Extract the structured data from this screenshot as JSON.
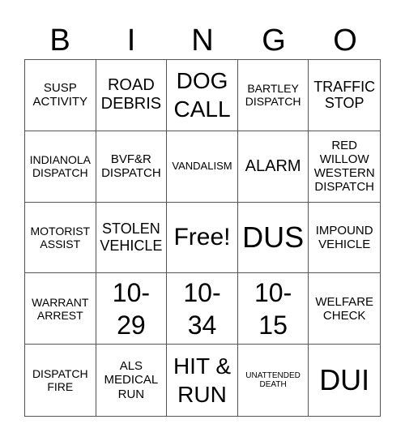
{
  "header": {
    "letters": [
      "B",
      "I",
      "N",
      "G",
      "O"
    ]
  },
  "board": {
    "rows": [
      [
        {
          "text": "SUSP\nACTIVITY"
        },
        {
          "text": "ROAD\nDEBRIS"
        },
        {
          "text": "DOG\nCALL"
        },
        {
          "text": "BARTLEY\nDISPATCH"
        },
        {
          "text": "TRAFFIC\nSTOP"
        }
      ],
      [
        {
          "text": "INDIANOLA\nDISPATCH"
        },
        {
          "text": "BVF&R\nDISPATCH"
        },
        {
          "text": "VANDALISM"
        },
        {
          "text": "ALARM"
        },
        {
          "text": "RED\nWILLOW\nWESTERN\nDISPATCH"
        }
      ],
      [
        {
          "text": "MOTORIST\nASSIST"
        },
        {
          "text": "STOLEN\nVEHICLE"
        },
        {
          "text": "Free!"
        },
        {
          "text": "DUS"
        },
        {
          "text": "IMPOUND\nVEHICLE"
        }
      ],
      [
        {
          "text": "WARRANT\nARREST"
        },
        {
          "text": "10-\n29"
        },
        {
          "text": "10-\n34"
        },
        {
          "text": "10-\n15"
        },
        {
          "text": "WELFARE\nCHECK"
        }
      ],
      [
        {
          "text": "DISPATCH\nFIRE"
        },
        {
          "text": "ALS\nMEDICAL\nRUN"
        },
        {
          "text": "HIT &\nRUN"
        },
        {
          "text": "UNATTENDED\nDEATH"
        },
        {
          "text": "DUI"
        }
      ]
    ]
  }
}
